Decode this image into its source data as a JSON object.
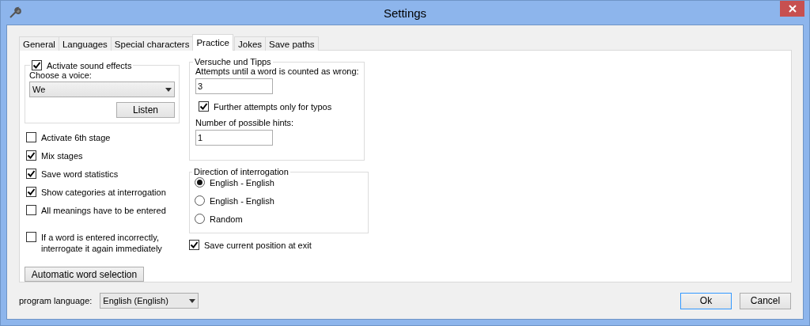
{
  "window": {
    "title": "Settings"
  },
  "tabs": [
    {
      "label": "General",
      "selected": false
    },
    {
      "label": "Languages",
      "selected": false
    },
    {
      "label": "Special characters",
      "selected": false
    },
    {
      "label": "Practice",
      "selected": true
    },
    {
      "label": "Jokes",
      "selected": false
    },
    {
      "label": "Save paths",
      "selected": false
    }
  ],
  "sound": {
    "label": "Activate sound effects",
    "checked": true,
    "voice_label": "Choose a voice:",
    "voice_value": "We",
    "listen_button": "Listen"
  },
  "options": [
    {
      "label": "Activate 6th stage",
      "checked": false
    },
    {
      "label": "Mix stages",
      "checked": true
    },
    {
      "label": "Save word statistics",
      "checked": true
    },
    {
      "label": "Show categories at interrogation",
      "checked": true
    },
    {
      "label": "All meanings have to be entered",
      "checked": false
    }
  ],
  "retry_option": {
    "label": "If a word is entered incorrectly,\ninterrogate it again immediately",
    "checked": false
  },
  "auto_button": "Automatic word selection",
  "attempts": {
    "title": "Versuche und Tipps",
    "attempts_label": "Attempts until a word is counted as wrong:",
    "attempts_field": {
      "value": "3"
    },
    "typos": {
      "label": "Further attempts only for typos",
      "checked": true
    },
    "hints_label": "Number of possible hints:",
    "hints_field": {
      "value": "1"
    }
  },
  "direction": {
    "title": "Direction of interrogation",
    "options": [
      {
        "label": "English - English",
        "selected": true
      },
      {
        "label": "English - English",
        "selected": false
      },
      {
        "label": "Random",
        "selected": false
      }
    ]
  },
  "save_position": {
    "label": "Save current position at exit",
    "checked": true
  },
  "program_language": {
    "label": "program language:",
    "value": "English (English)"
  },
  "buttons": [
    {
      "label": "Ok",
      "default": true
    },
    {
      "label": "Cancel",
      "default": false
    }
  ]
}
